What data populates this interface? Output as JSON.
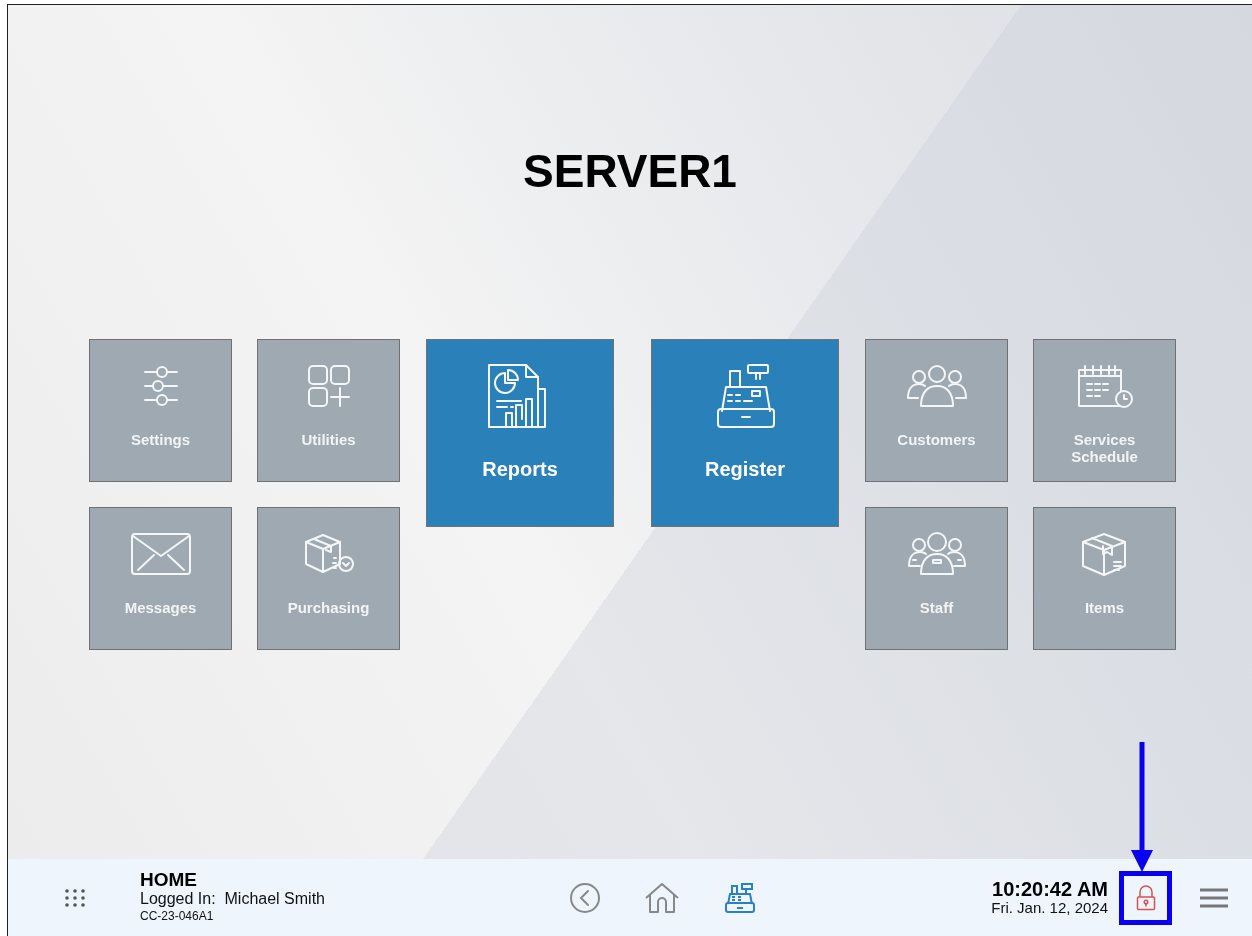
{
  "title": "SERVER1",
  "tile_groups": [
    {
      "tiles": [
        {
          "label": "Settings",
          "kind": "small"
        },
        {
          "label": "Utilities",
          "kind": "small"
        },
        {
          "label": "Messages",
          "kind": "small"
        },
        {
          "label": "Purchasing",
          "kind": "small"
        }
      ]
    },
    {
      "tiles": [
        {
          "label": "Reports",
          "kind": "large"
        },
        {
          "label": "Register",
          "kind": "large"
        }
      ]
    },
    {
      "tiles": [
        {
          "label": "Customers",
          "kind": "small"
        },
        {
          "label": "Services Schedule",
          "kind": "small"
        },
        {
          "label": "Staff",
          "kind": "small"
        },
        {
          "label": "Items",
          "kind": "small"
        }
      ]
    }
  ],
  "status_bar": {
    "section": "HOME",
    "login_label": "Logged In:",
    "user": "Michael Smith",
    "terminal": "CC-23-046A1",
    "nav": [
      {
        "selected": false
      },
      {
        "selected": false
      },
      {
        "selected": true
      }
    ],
    "time": "10:20:42 AM",
    "date": "Fri. Jan. 12, 2024",
    "lock": {
      "highlighted": true
    }
  }
}
